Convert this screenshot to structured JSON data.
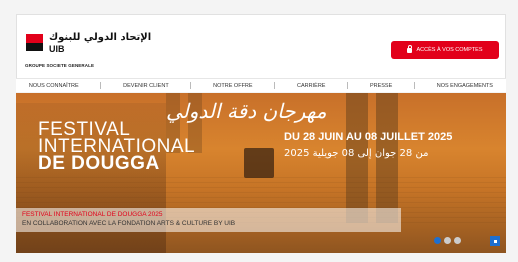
{
  "brand": {
    "name_ar": "الإتحاد الدولي للبنوك",
    "name_short": "UIB",
    "group": "GROUPE SOCIETE GENERALE",
    "logo_color": "#e2001a"
  },
  "header": {
    "access_button": "ACCÈS À VOS COMPTES",
    "access_icon": "lock-icon"
  },
  "nav": {
    "items": [
      {
        "label": "NOUS CONNAÎTRE"
      },
      {
        "label": "DEVENIR CLIENT"
      },
      {
        "label": "NOTRE OFFRE"
      },
      {
        "label": "CARRIÈRE"
      },
      {
        "label": "PRESSE"
      },
      {
        "label": "NOS ENGAGEMENTS"
      }
    ]
  },
  "banner": {
    "title_line1": "FESTIVAL",
    "title_line2": "INTERNATIONAL",
    "title_line3": "DE DOUGGA",
    "title_ar": "مهرجان دقة الدولي",
    "dates_fr": "DU 28 JUIN AU 08 JUILLET 2025",
    "dates_ar": "من 28 جوان إلى 08 جويلية 2025",
    "caption_title": "FESTIVAL INTERNATIONAL DE DOUGGA 2025",
    "caption_sub": "EN COLLABORATION AVEC LA FONDATION ARTS & CULTURE BY UIB",
    "slides_total": 3,
    "active_slide": 1
  },
  "colors": {
    "accent": "#e2001a",
    "pager_active": "#1d6fd0"
  }
}
